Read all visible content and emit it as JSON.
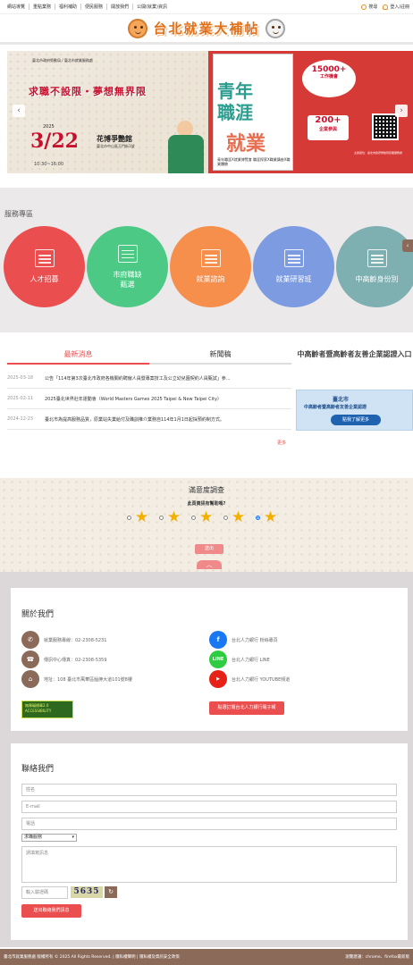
{
  "topnav": {
    "links": [
      "網站導覽",
      "重點業務",
      "福利補助",
      "便民服務",
      "開放我們",
      "公開(就業)資訊"
    ],
    "search_label": "搜尋",
    "login_label": "登入/註冊"
  },
  "header": {
    "logo_text": "台北就業大補帖"
  },
  "banner": {
    "org": "臺北市政府勞動局 / 臺北市就業服務處",
    "slogan": "求職不設限‧夢想無界限",
    "year": "2025",
    "date": "3/22",
    "time": "10:30~16:00",
    "venue": "花博爭艷館",
    "venue_sub": "臺北市中山區玉門街1號",
    "poster_title_1": "青年",
    "poster_title_2": "職涯",
    "poster_title_3": "就業",
    "poster_foot": "青年職涯X就業博覽會 職涯探索X職業講座X職業體驗",
    "badge_num": "15000+",
    "badge_sub": "工作機會",
    "badge2_num": "200+",
    "badge2_sub": "企業參與",
    "footnote": "主辦單位：臺北市政府勞動局就業服務處",
    "prev_label": "‹",
    "next_label": "›"
  },
  "services": {
    "title": "服務專區",
    "items": [
      {
        "label": "人才招募"
      },
      {
        "label": "市府職缺\n甄選"
      },
      {
        "label": "就業諮詢"
      },
      {
        "label": "就業研習班"
      },
      {
        "label": "中高齡身份別"
      }
    ],
    "side_tab": "‹"
  },
  "news": {
    "tabs": [
      "最新消息",
      "新聞稿"
    ],
    "items": [
      {
        "date": "2025-03-18",
        "title": "公告「114年第3次臺北市政府各機關約聘僱人員暨專案技工及公立幼兒園契約人員甄試」參..."
      },
      {
        "date": "2025-02-11",
        "title": "2025臺北世界壯年運動會（World Masters Games 2025 Taipei & New Taipei City）"
      },
      {
        "date": "2024-12-23",
        "title": "臺北市為提高服務品質，原業站失業給付及職訓推介業務自114年1月1日起採預約制方式。"
      }
    ],
    "more": "更多"
  },
  "senior": {
    "title": "中高齡者暨高齡者友善企業認證入口",
    "banner_l1": "臺北市",
    "banner_l2": "中高齡者暨高齡者友善企業認證",
    "banner_btn": "點我了解更多"
  },
  "survey": {
    "title": "滿意度調查",
    "question": "此頁資訊有幫助嗎?",
    "selected": 5,
    "submit": "送出",
    "collapse": "︿"
  },
  "about": {
    "title": "關於我們",
    "phone": "就業服務專線：02-2308-5231",
    "fax": "傳訊中心傳真：02-2308-5359",
    "address": "地址：108 臺北市萬華區艋舺大道101號8樓",
    "fb": "台北人力銀行 粉絲專頁",
    "line": "台北人力銀行 LINE",
    "yt": "台北人力銀行 YOUTUBE頻道",
    "acc_badge": "無障礙標章2.0 ACCESSIBILITY",
    "join_btn": "點選訂閱台北人力銀行電子報"
  },
  "contact": {
    "title": "聯絡我們",
    "name_ph": "姓名",
    "email_ph": "E-mail",
    "phone_ph": "電話",
    "select_value": "求職服務",
    "message_ph": "請填寫訊息",
    "captcha_ph": "輸入驗證碼",
    "captcha_code": "5635",
    "submit": "送出聯絡我們訊息"
  },
  "footer": {
    "left": "臺北市就業服務處 版權所有 © 2025 All Rights Reserved. | 隱私權聲明 | 隱私權及資訊安全政策",
    "right": "瀏覽建議：chrome、firefox最新版"
  },
  "colors": {
    "accent": "#ea4e4f",
    "brand": "#e0701a",
    "footer": "#8b6a5a"
  }
}
